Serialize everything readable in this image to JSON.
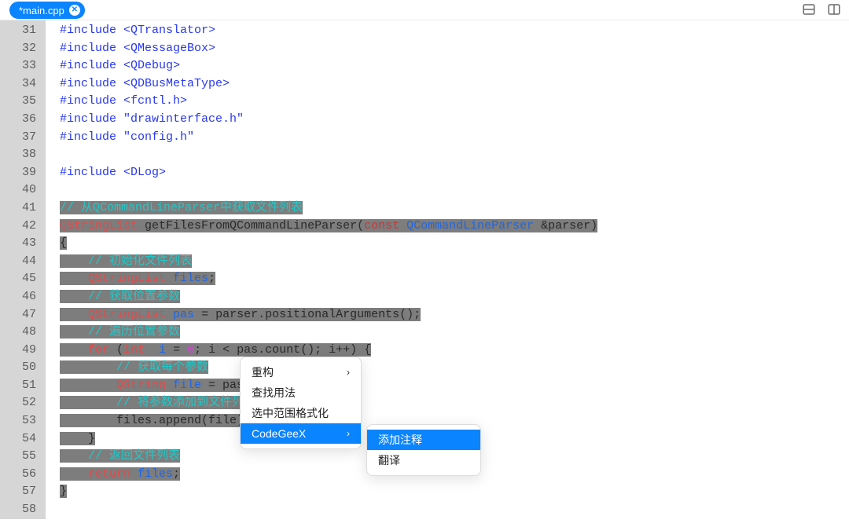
{
  "tab": {
    "label": "*main.cpp"
  },
  "lines": [
    {
      "n": 31,
      "sel": false,
      "tokens": [
        [
          "t-pre",
          "#include "
        ],
        [
          "t-inc",
          "<QTranslator>"
        ]
      ]
    },
    {
      "n": 32,
      "sel": false,
      "tokens": [
        [
          "t-pre",
          "#include "
        ],
        [
          "t-inc",
          "<QMessageBox>"
        ]
      ]
    },
    {
      "n": 33,
      "sel": false,
      "tokens": [
        [
          "t-pre",
          "#include "
        ],
        [
          "t-inc",
          "<QDebug>"
        ]
      ]
    },
    {
      "n": 34,
      "sel": false,
      "tokens": [
        [
          "t-pre",
          "#include "
        ],
        [
          "t-inc",
          "<QDBusMetaType>"
        ]
      ]
    },
    {
      "n": 35,
      "sel": false,
      "tokens": [
        [
          "t-pre",
          "#include "
        ],
        [
          "t-inc",
          "<fcntl.h>"
        ]
      ]
    },
    {
      "n": 36,
      "sel": false,
      "tokens": [
        [
          "t-pre",
          "#include "
        ],
        [
          "t-inc",
          "\"drawinterface.h\""
        ]
      ]
    },
    {
      "n": 37,
      "sel": false,
      "tokens": [
        [
          "t-pre",
          "#include "
        ],
        [
          "t-inc",
          "\"config.h\""
        ]
      ]
    },
    {
      "n": 38,
      "sel": false,
      "tokens": []
    },
    {
      "n": 39,
      "sel": false,
      "tokens": [
        [
          "t-pre",
          "#include "
        ],
        [
          "t-inc",
          "<DLog>"
        ]
      ]
    },
    {
      "n": 40,
      "sel": false,
      "tokens": []
    },
    {
      "n": 41,
      "sel": true,
      "tokens": [
        [
          "t-cmt",
          "// 从QCommandLineParser中获取文件列表"
        ]
      ]
    },
    {
      "n": 42,
      "sel": true,
      "tokens": [
        [
          "t-cls",
          "QStringList"
        ],
        [
          "t-id",
          " getFilesFromQCommandLineParser("
        ],
        [
          "t-const",
          "const "
        ],
        [
          "t-type2",
          "QCommandLineParser "
        ],
        [
          "t-id",
          "&parser)"
        ]
      ]
    },
    {
      "n": 43,
      "sel": true,
      "tokens": [
        [
          "t-punc",
          "{"
        ]
      ]
    },
    {
      "n": 44,
      "sel": true,
      "indent": 1,
      "tokens": [
        [
          "t-cmt",
          "// 初始化文件列表"
        ]
      ]
    },
    {
      "n": 45,
      "sel": true,
      "indent": 1,
      "tokens": [
        [
          "t-cls",
          "QStringList "
        ],
        [
          "t-varb",
          "files"
        ],
        [
          "t-punc",
          ";"
        ]
      ]
    },
    {
      "n": 46,
      "sel": true,
      "indent": 1,
      "tokens": [
        [
          "t-cmt",
          "// 获取位置参数"
        ]
      ]
    },
    {
      "n": 47,
      "sel": true,
      "indent": 1,
      "tokens": [
        [
          "t-cls",
          "QStringList "
        ],
        [
          "t-varb",
          "pas "
        ],
        [
          "t-id",
          "= parser.positionalArguments();"
        ]
      ]
    },
    {
      "n": 48,
      "sel": true,
      "indent": 1,
      "tokens": [
        [
          "t-cmt",
          "// 遍历位置参数"
        ]
      ]
    },
    {
      "n": 49,
      "sel": true,
      "indent": 1,
      "tokens": [
        [
          "t-kw",
          "for "
        ],
        [
          "t-punc",
          "("
        ],
        [
          "t-kw",
          "int  "
        ],
        [
          "t-varb",
          "i "
        ],
        [
          "t-id",
          "= "
        ],
        [
          "t-num",
          "0"
        ],
        [
          "t-id",
          "; i < pas.count(); i++) {"
        ]
      ]
    },
    {
      "n": 50,
      "sel": true,
      "indent": 2,
      "tokens": [
        [
          "t-cmt",
          "// 获取每个参数"
        ]
      ]
    },
    {
      "n": 51,
      "sel": true,
      "indent": 2,
      "tokens": [
        [
          "t-cls",
          "QString "
        ],
        [
          "t-varb",
          "file "
        ],
        [
          "t-id",
          "= pas.at(i);"
        ]
      ]
    },
    {
      "n": 52,
      "sel": true,
      "indent": 2,
      "tokens": [
        [
          "t-cmt",
          "// 将参数添加到文件列表中"
        ]
      ]
    },
    {
      "n": 53,
      "sel": true,
      "indent": 2,
      "tokens": [
        [
          "t-id",
          "files.append(file);"
        ]
      ]
    },
    {
      "n": 54,
      "sel": true,
      "indent": 1,
      "tokens": [
        [
          "t-punc",
          "}"
        ]
      ]
    },
    {
      "n": 55,
      "sel": true,
      "indent": 1,
      "tokens": [
        [
          "t-cmt",
          "// 返回文件列表"
        ]
      ]
    },
    {
      "n": 56,
      "sel": true,
      "indent": 1,
      "tokens": [
        [
          "t-ret",
          "return "
        ],
        [
          "t-varb",
          "files"
        ],
        [
          "t-punc",
          ";"
        ]
      ]
    },
    {
      "n": 57,
      "sel": true,
      "tokens": [
        [
          "t-punc",
          "}"
        ]
      ]
    },
    {
      "n": 58,
      "sel": false,
      "tokens": []
    }
  ],
  "menu1": {
    "items": [
      {
        "label": "重构",
        "hasSub": true,
        "active": false
      },
      {
        "label": "查找用法",
        "hasSub": false,
        "active": false
      },
      {
        "label": "选中范围格式化",
        "hasSub": false,
        "active": false
      },
      {
        "label": "CodeGeeX",
        "hasSub": true,
        "active": true
      }
    ]
  },
  "menu2": {
    "items": [
      {
        "label": "添加注释",
        "active": true
      },
      {
        "label": "翻译",
        "active": false
      }
    ]
  }
}
